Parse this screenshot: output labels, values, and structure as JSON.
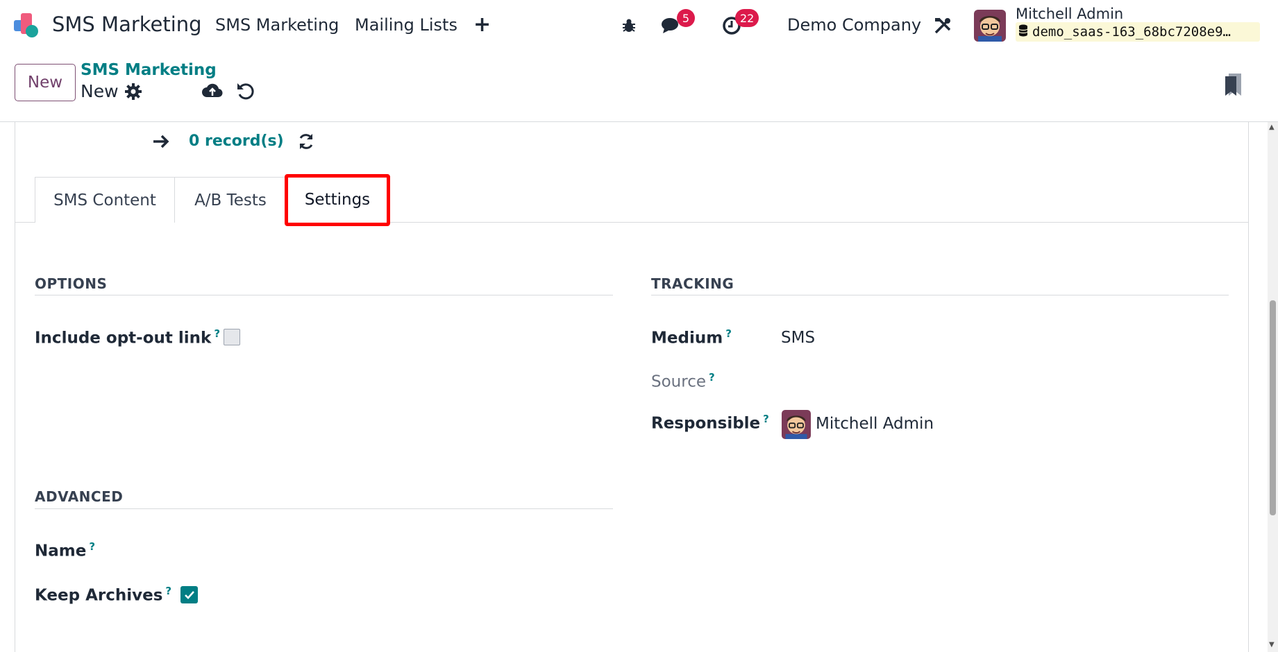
{
  "navbar": {
    "app_name": "SMS Marketing",
    "menu": [
      "SMS Marketing",
      "Mailing Lists"
    ],
    "plus_symbol": "+",
    "messages_badge": "5",
    "activities_badge": "22",
    "company": "Demo Company",
    "user_name": "Mitchell Admin",
    "database": "demo_saas-163_68bc7208e9…",
    "icons": {
      "app_logo": "app-logo-icon",
      "debug": "bug-icon",
      "messages": "chat-icon",
      "activities": "clock-icon",
      "settings": "tools-icon",
      "database": "database-icon"
    }
  },
  "control_panel": {
    "new_label": "New",
    "breadcrumb": "SMS Marketing",
    "record_name": "New",
    "icons": {
      "gear": "gear-icon",
      "save": "cloud-upload-icon",
      "discard": "undo-icon",
      "bookmark": "bookmark-icon"
    }
  },
  "form": {
    "records_label": "0 record(s)",
    "tabs": [
      "SMS Content",
      "A/B Tests",
      "Settings"
    ],
    "active_tab": "Settings",
    "options": {
      "title": "OPTIONS",
      "include_optout_label": "Include opt-out link",
      "include_optout_checked": false
    },
    "tracking": {
      "title": "TRACKING",
      "medium_label": "Medium",
      "medium_value": "SMS",
      "source_label": "Source",
      "source_value": "",
      "responsible_label": "Responsible",
      "responsible_value": "Mitchell Admin"
    },
    "advanced": {
      "title": "ADVANCED",
      "name_label": "Name",
      "name_value": "",
      "keep_archives_label": "Keep Archives",
      "keep_archives_checked": true
    },
    "help_mark": "?"
  },
  "colors": {
    "accent_teal": "#017e84",
    "brand_purple": "#71406b",
    "badge_red": "#dc1a4b",
    "highlight_red": "#ff0000"
  }
}
